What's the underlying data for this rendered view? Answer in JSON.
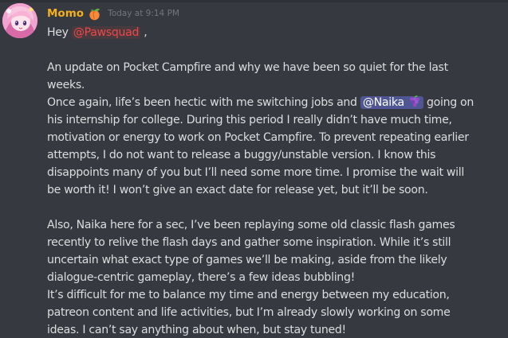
{
  "message": {
    "author": {
      "name": "Momo",
      "name_color": "#f2b01e",
      "badge_icon": "peach-icon"
    },
    "timestamp": "Today at 9:14 PM",
    "greeting": {
      "prefix": "Hey ",
      "mention": "@Pawsquad",
      "suffix": " ,"
    },
    "paragraph1": {
      "lines": [
        "An update on Pocket Campfire and why we have been so quiet for the last",
        "weeks."
      ],
      "line3": {
        "before": "Once again, life’s been hectic with me switching jobs and ",
        "mention": "@Naika",
        "mention_icon": "grapes-icon",
        "after": " going on"
      },
      "rest": [
        "his internship for college. During this period I really didn’t have much time,",
        "motivation or energy to work on Pocket Campfire. To prevent repeating earlier",
        "attempts, I do not want to release a buggy/unstable version. I know this",
        "disappoints many of you but I’ll need some more time. I promise the wait will",
        "be worth it! I won’t give an exact date for release yet, but it’ll be soon."
      ]
    },
    "paragraph2": {
      "lines": [
        "Also, Naika here for a sec, I’ve been replaying some old classic flash games",
        "recently to relive the flash days and gather some inspiration. While it’s still",
        "uncertain what exact type of games we’ll be making, aside from the likely",
        "dialogue-centric gameplay, there’s a few ideas bubbling!",
        "It’s difficult for me to balance my time and energy between my education,",
        "patreon content and life activities, but I’m already slowly working on some",
        "ideas. I can’t say anything about when, but stay tuned!"
      ]
    }
  },
  "colors": {
    "background": "#36393f",
    "text": "#dcddde",
    "timestamp": "#72767d",
    "role_mention": "#f04747",
    "user_mention_bg": "#4f5693"
  }
}
